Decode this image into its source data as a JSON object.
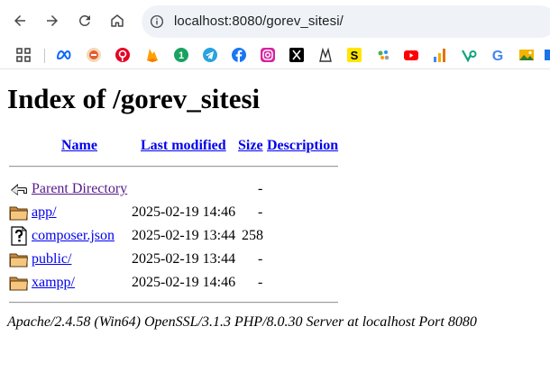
{
  "browser": {
    "url": "localhost:8080/gorev_sitesi/"
  },
  "bookmarks": [
    {
      "icon": "apps-grid-icon"
    },
    {
      "icon": "meta-icon",
      "color": "#0866ff"
    },
    {
      "icon": "bookmark-red-icon",
      "color": "#e65c2c"
    },
    {
      "icon": "pinterest-icon",
      "color": "#e60023"
    },
    {
      "icon": "firebase-icon",
      "color": "#ffa000"
    },
    {
      "icon": "green-number-icon",
      "color": "#1aa260",
      "text": "1"
    },
    {
      "icon": "telegram-icon",
      "color": "#2aa3df"
    },
    {
      "icon": "facebook-icon",
      "color": "#1877f2"
    },
    {
      "icon": "instagram-icon",
      "color": "#e1306c"
    },
    {
      "icon": "x-icon",
      "color": "#000000"
    },
    {
      "icon": "anime-icon",
      "color": "#333333"
    },
    {
      "icon": "yellow-s-icon",
      "color": "#ffe600",
      "text": "S"
    },
    {
      "icon": "colorful-dots-icon",
      "color": "#4caf50"
    },
    {
      "icon": "youtube-icon",
      "color": "#ff0000"
    },
    {
      "icon": "bar-chart-icon",
      "color": "#f9ab00"
    },
    {
      "icon": "vercel-v-icon",
      "color": "#10a37f"
    },
    {
      "icon": "google-g-icon",
      "color": "#4285f4",
      "text": "G"
    },
    {
      "icon": "image-icon",
      "color": "#f6b400"
    },
    {
      "icon": "partial-icon",
      "color": "#1a73e8"
    }
  ],
  "page": {
    "title": "Index of /gorev_sitesi",
    "columns": {
      "name": "Name",
      "last_modified": "Last modified",
      "size": "Size",
      "description": "Description"
    },
    "rows": [
      {
        "icon": "back-arrow-icon",
        "name": "Parent Directory",
        "date": "",
        "size": "-",
        "visited": true
      },
      {
        "icon": "folder-icon",
        "name": "app/",
        "date": "2025-02-19 14:46",
        "size": "-"
      },
      {
        "icon": "unknown-file-icon",
        "name": "composer.json",
        "date": "2025-02-19 13:44",
        "size": "258"
      },
      {
        "icon": "folder-icon",
        "name": "public/",
        "date": "2025-02-19 13:44",
        "size": "-"
      },
      {
        "icon": "folder-icon",
        "name": "xampp/",
        "date": "2025-02-19 14:46",
        "size": "-"
      }
    ],
    "server_signature": "Apache/2.4.58 (Win64) OpenSSL/3.1.3 PHP/8.0.30 Server at localhost Port 8080"
  }
}
